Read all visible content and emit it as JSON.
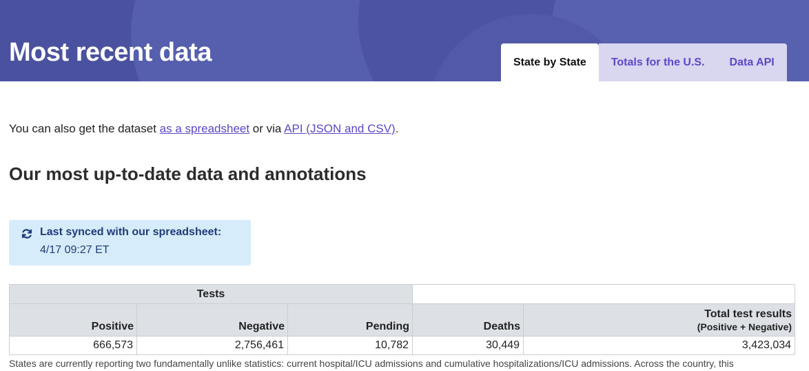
{
  "header": {
    "title": "Most recent data",
    "tabs": [
      {
        "label": "State by State"
      },
      {
        "label": "Totals for the U.S."
      },
      {
        "label": "Data API"
      }
    ]
  },
  "intro": {
    "text_before": "You can also get the dataset ",
    "spreadsheet_link": "as a spreadsheet",
    "text_middle": " or via ",
    "api_link": "API (JSON and CSV)",
    "text_after": "."
  },
  "section_heading": "Our most up-to-date data and annotations",
  "sync": {
    "icon": "sync-icon",
    "title": "Last synced with our spreadsheet:",
    "time": "4/17 09:27 ET"
  },
  "table": {
    "group_header": "Tests",
    "columns": [
      {
        "label": "Positive"
      },
      {
        "label": "Negative"
      },
      {
        "label": "Pending"
      },
      {
        "label": "Deaths"
      },
      {
        "label": "Total test results",
        "sub": "(Positive + Negative)"
      }
    ],
    "row": [
      "666,573",
      "2,756,461",
      "10,782",
      "30,449",
      "3,423,034"
    ]
  },
  "note": "States are currently reporting two fundamentally unlike statistics: current hospital/ICU admissions and cumulative hospitalizations/ICU admissions. Across the country, this",
  "colors": {
    "header_bg": "#5059a8",
    "tab_inactive_bg": "#d9d6f0",
    "tab_inactive_text": "#5c47c7",
    "link": "#5c47c7",
    "sync_bg": "#d7ecfb",
    "sync_text": "#1e3c7a",
    "table_header_bg": "#dde1e6"
  }
}
